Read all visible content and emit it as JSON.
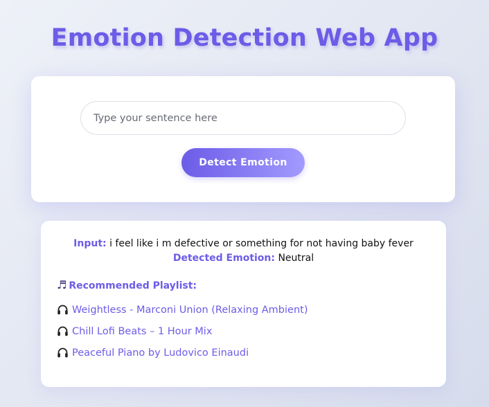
{
  "page": {
    "title": "Emotion Detection Web App"
  },
  "form": {
    "placeholder": "Type your sentence here",
    "button_label": "Detect Emotion"
  },
  "result": {
    "input_label": "Input:",
    "input_text": "i feel like i m defective or something for not having baby fever",
    "emotion_label": "Detected Emotion:",
    "emotion_value": "Neutral"
  },
  "playlist": {
    "icon": "music-note-icon",
    "heading": "Recommended Playlist:",
    "item_icon": "headphones-icon",
    "items": [
      {
        "label": "Weightless - Marconi Union (Relaxing Ambient)"
      },
      {
        "label": "Chill Lofi Beats – 1 Hour Mix"
      },
      {
        "label": "Peaceful Piano by Ludovico Einaudi"
      }
    ]
  },
  "colors": {
    "accent": "#6c5ce7",
    "accent_light": "#a29bfe",
    "card_background": "#ffffff"
  }
}
